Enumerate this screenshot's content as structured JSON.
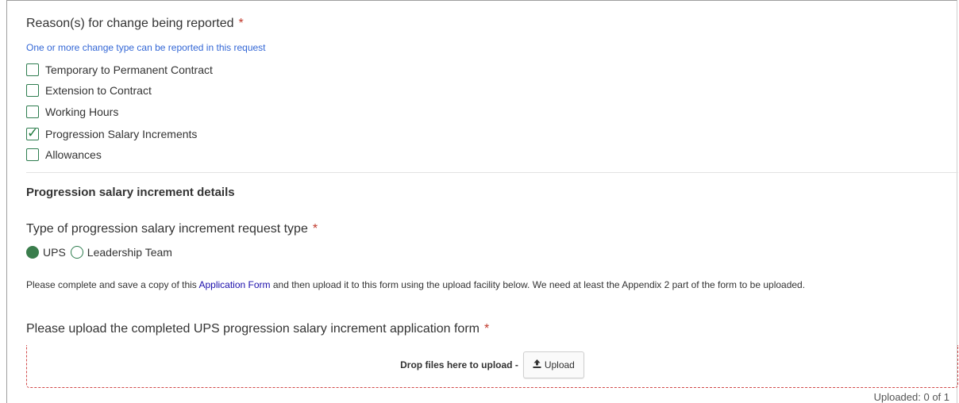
{
  "reasons": {
    "label": "Reason(s) for change being reported",
    "required_mark": "*",
    "hint": "One or more change type can be reported in this request",
    "options": [
      {
        "label": "Temporary to Permanent Contract",
        "checked": false
      },
      {
        "label": "Extension to Contract",
        "checked": false
      },
      {
        "label": "Working Hours",
        "checked": false
      },
      {
        "label": "Progression Salary Increments",
        "checked": true
      },
      {
        "label": "Allowances",
        "checked": false
      }
    ],
    "check_glyph": "✓"
  },
  "progression": {
    "section_title": "Progression salary increment details",
    "type_label": "Type of progression salary increment request type",
    "required_mark": "*",
    "radio_options": [
      {
        "label": "UPS",
        "selected": true
      },
      {
        "label": "Leadership Team",
        "selected": false
      }
    ],
    "instructions_before": "Please complete and save a copy of this ",
    "instructions_link": "Application Form",
    "instructions_after": " and then upload it to this form using the upload facility below.  We need at least the Appendix 2 part of the form to be uploaded.",
    "upload_label": "Please upload the completed UPS progression salary increment application form",
    "upload_required_mark": "*",
    "drop_text": "Drop files here to upload -",
    "upload_button": "Upload",
    "upload_icon": "upload-icon",
    "uploaded_status": "Uploaded: 0 of 1"
  },
  "colors": {
    "accent_green": "#3a7d4c",
    "hint_blue": "#3367d6",
    "required_red": "#c0392b",
    "link_blue": "#1a0dab",
    "dropzone_border": "#d24a4a"
  }
}
